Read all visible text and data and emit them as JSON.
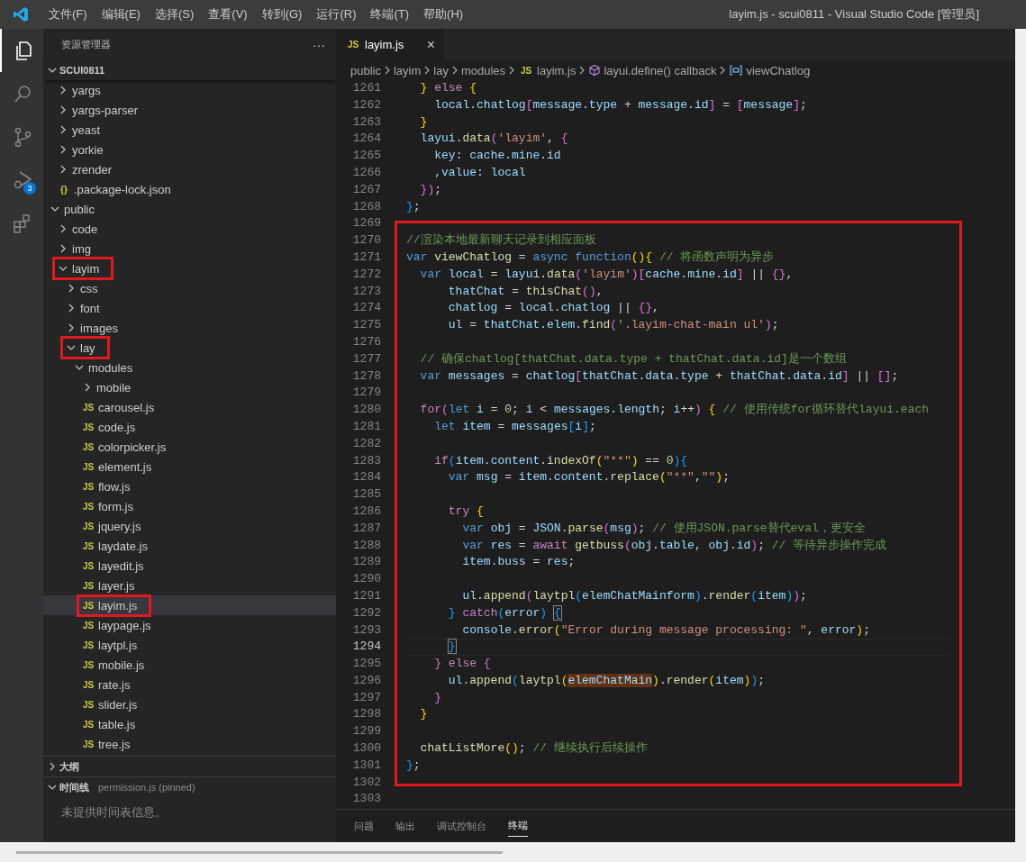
{
  "title_bar": {
    "menu": [
      "文件(F)",
      "编辑(E)",
      "选择(S)",
      "查看(V)",
      "转到(G)",
      "运行(R)",
      "终端(T)",
      "帮助(H)"
    ],
    "title": "layim.js - scui0811 - Visual Studio Code [管理员]"
  },
  "activity_bar": [
    {
      "kind": "files",
      "selected": true
    },
    {
      "kind": "search",
      "selected": false
    },
    {
      "kind": "source-control",
      "selected": false
    },
    {
      "kind": "debug",
      "selected": false,
      "badge": "3"
    },
    {
      "kind": "extensions",
      "selected": false
    }
  ],
  "sidebar": {
    "title": "资源管理器",
    "more": "···",
    "root": {
      "name": "SCUI0811",
      "expanded": true
    },
    "tree": [
      {
        "children": [
          {
            "name": "yargs",
            "kind": "folder",
            "expanded": false,
            "selected": false,
            "annotated": false
          },
          {
            "name": "yargs-parser",
            "kind": "folder",
            "expanded": false,
            "selected": false,
            "annotated": false
          },
          {
            "name": "yeast",
            "kind": "folder",
            "expanded": false,
            "selected": false,
            "annotated": false
          },
          {
            "name": "yorkie",
            "kind": "folder",
            "expanded": false,
            "selected": false,
            "annotated": false
          },
          {
            "name": "zrender",
            "kind": "folder",
            "expanded": false,
            "selected": false,
            "annotated": false
          },
          {
            "name": ".package-lock.json",
            "kind": "json",
            "icon_label": "{}",
            "selected": false,
            "annotated": false
          }
        ]
      },
      {
        "name": "public",
        "kind": "folder",
        "expanded": true,
        "selected": false,
        "annotated": false,
        "children": [
          {
            "name": "code",
            "kind": "folder",
            "expanded": false,
            "selected": false,
            "annotated": false
          },
          {
            "name": "img",
            "kind": "folder",
            "expanded": false,
            "selected": false,
            "annotated": false
          },
          {
            "name": "layim",
            "kind": "folder",
            "expanded": true,
            "selected": false,
            "annotated": true,
            "children": [
              {
                "name": "css",
                "kind": "folder",
                "expanded": false,
                "selected": false,
                "annotated": false
              },
              {
                "name": "font",
                "kind": "folder",
                "expanded": false,
                "selected": false,
                "annotated": false
              },
              {
                "name": "images",
                "kind": "folder",
                "expanded": false,
                "selected": false,
                "annotated": false
              },
              {
                "name": "lay",
                "kind": "folder",
                "expanded": true,
                "selected": false,
                "annotated": true,
                "children": [
                  {
                    "name": "modules",
                    "kind": "folder",
                    "expanded": true,
                    "selected": false,
                    "annotated": false,
                    "children": [
                      {
                        "name": "mobile",
                        "kind": "folder",
                        "expanded": false,
                        "selected": false,
                        "annotated": false
                      },
                      {
                        "name": "carousel.js",
                        "kind": "js",
                        "icon_label": "JS",
                        "selected": false,
                        "annotated": false
                      },
                      {
                        "name": "code.js",
                        "kind": "js",
                        "icon_label": "JS",
                        "selected": false,
                        "annotated": false
                      },
                      {
                        "name": "colorpicker.js",
                        "kind": "js",
                        "icon_label": "JS",
                        "selected": false,
                        "annotated": false
                      },
                      {
                        "name": "element.js",
                        "kind": "js",
                        "icon_label": "JS",
                        "selected": false,
                        "annotated": false
                      },
                      {
                        "name": "flow.js",
                        "kind": "js",
                        "icon_label": "JS",
                        "selected": false,
                        "annotated": false
                      },
                      {
                        "name": "form.js",
                        "kind": "js",
                        "icon_label": "JS",
                        "selected": false,
                        "annotated": false
                      },
                      {
                        "name": "jquery.js",
                        "kind": "js",
                        "icon_label": "JS",
                        "selected": false,
                        "annotated": false
                      },
                      {
                        "name": "laydate.js",
                        "kind": "js",
                        "icon_label": "JS",
                        "selected": false,
                        "annotated": false
                      },
                      {
                        "name": "layedit.js",
                        "kind": "js",
                        "icon_label": "JS",
                        "selected": false,
                        "annotated": false
                      },
                      {
                        "name": "layer.js",
                        "kind": "js",
                        "icon_label": "JS",
                        "selected": false,
                        "annotated": false
                      },
                      {
                        "name": "layim.js",
                        "kind": "js",
                        "icon_label": "JS",
                        "selected": true,
                        "annotated": true
                      },
                      {
                        "name": "laypage.js",
                        "kind": "js",
                        "icon_label": "JS",
                        "selected": false,
                        "annotated": false
                      },
                      {
                        "name": "laytpl.js",
                        "kind": "js",
                        "icon_label": "JS",
                        "selected": false,
                        "annotated": false
                      },
                      {
                        "name": "mobile.js",
                        "kind": "js",
                        "icon_label": "JS",
                        "selected": false,
                        "annotated": false
                      },
                      {
                        "name": "rate.js",
                        "kind": "js",
                        "icon_label": "JS",
                        "selected": false,
                        "annotated": false
                      },
                      {
                        "name": "slider.js",
                        "kind": "js",
                        "icon_label": "JS",
                        "selected": false,
                        "annotated": false
                      },
                      {
                        "name": "table.js",
                        "kind": "js",
                        "icon_label": "JS",
                        "selected": false,
                        "annotated": false
                      },
                      {
                        "name": "tree.js",
                        "kind": "js",
                        "icon_label": "JS",
                        "selected": false,
                        "annotated": false
                      }
                    ]
                  }
                ]
              }
            ]
          }
        ]
      }
    ],
    "sections": [
      {
        "title": "大纲",
        "expanded": false
      },
      {
        "title": "时间线",
        "expanded": true,
        "detail": "permission.js (pinned)",
        "message": "未提供时间表信息。"
      }
    ]
  },
  "editor": {
    "tabs": [
      {
        "label": "layim.js",
        "icon_label": "JS",
        "selected": true,
        "close": "×"
      }
    ],
    "breadcrumbs": [
      {
        "text": "public",
        "kind": "folder"
      },
      {
        "text": "layim",
        "kind": "folder"
      },
      {
        "text": "lay",
        "kind": "folder"
      },
      {
        "text": "modules",
        "kind": "folder"
      },
      {
        "text": "layim.js",
        "kind": "js",
        "icon_label": "JS"
      },
      {
        "text": "layui.define() callback",
        "kind": "method"
      },
      {
        "text": "viewChatlog",
        "kind": "variable"
      }
    ],
    "blocks": [
      {
        "kind": "plain",
        "lines": [
          {
            "n": "1261",
            "current": false,
            "tokens": [
              {
                "text": "  } ",
                "kind": "b1"
              },
              {
                "text": "else ",
                "kind": "ctl"
              },
              {
                "text": "{",
                "kind": "b1"
              }
            ]
          },
          {
            "n": "1262",
            "current": false,
            "tokens": [
              {
                "text": "    local.chatlog",
                "kind": "var"
              },
              {
                "text": "[",
                "kind": "b2"
              },
              {
                "text": "message.type",
                "kind": "var"
              },
              {
                "text": " + ",
                "kind": "p"
              },
              {
                "text": "message.id",
                "kind": "var"
              },
              {
                "text": "]",
                "kind": "b2"
              },
              {
                "text": " = ",
                "kind": "p"
              },
              {
                "text": "[",
                "kind": "b2"
              },
              {
                "text": "message",
                "kind": "var"
              },
              {
                "text": "]",
                "kind": "b2"
              },
              {
                "text": ";",
                "kind": "p"
              }
            ]
          },
          {
            "n": "1263",
            "current": false,
            "tokens": [
              {
                "text": "  }",
                "kind": "b1"
              }
            ]
          },
          {
            "n": "1264",
            "current": false,
            "tokens": [
              {
                "text": "  layui",
                "kind": "var"
              },
              {
                "text": ".",
                "kind": "p"
              },
              {
                "text": "data",
                "kind": "fn"
              },
              {
                "text": "(",
                "kind": "b2"
              },
              {
                "text": "'layim'",
                "kind": "str"
              },
              {
                "text": ", ",
                "kind": "p"
              },
              {
                "text": "{",
                "kind": "b2"
              }
            ]
          },
          {
            "n": "1265",
            "current": false,
            "tokens": [
              {
                "text": "    key",
                "kind": "var"
              },
              {
                "text": ": ",
                "kind": "p"
              },
              {
                "text": "cache.mine.id",
                "kind": "var"
              }
            ]
          },
          {
            "n": "1266",
            "current": false,
            "tokens": [
              {
                "text": "    ,value",
                "kind": "var"
              },
              {
                "text": ": ",
                "kind": "p"
              },
              {
                "text": "local",
                "kind": "var"
              }
            ]
          },
          {
            "n": "1267",
            "current": false,
            "tokens": [
              {
                "text": "  }",
                "kind": "b2"
              },
              {
                "text": ")",
                "kind": "b2"
              },
              {
                "text": ";",
                "kind": "p"
              }
            ]
          },
          {
            "n": "1268",
            "current": false,
            "tokens": [
              {
                "text": "}",
                "kind": "b3"
              },
              {
                "text": ";",
                "kind": "p"
              }
            ]
          },
          {
            "n": "1269",
            "current": false
          }
        ]
      },
      {
        "kind": "annotated",
        "lines": [
          {
            "n": "1270",
            "current": false,
            "tokens": [
              {
                "text": "//渲染本地最新聊天记录到相应面板",
                "kind": "cmt"
              }
            ]
          },
          {
            "n": "1271",
            "current": false,
            "tokens": [
              {
                "text": "var ",
                "kind": "kw"
              },
              {
                "text": "viewChatlog",
                "kind": "fn"
              },
              {
                "text": " = ",
                "kind": "p"
              },
              {
                "text": "async function",
                "kind": "kw"
              },
              {
                "text": "(){",
                "kind": "b1"
              },
              {
                "text": " // 将函数声明为异步",
                "kind": "cmt"
              }
            ]
          },
          {
            "n": "1272",
            "current": false,
            "tokens": [
              {
                "text": "  var ",
                "kind": "kw"
              },
              {
                "text": "local",
                "kind": "var"
              },
              {
                "text": " = ",
                "kind": "p"
              },
              {
                "text": "layui",
                "kind": "var"
              },
              {
                "text": ".",
                "kind": "p"
              },
              {
                "text": "data",
                "kind": "fn"
              },
              {
                "text": "(",
                "kind": "b2"
              },
              {
                "text": "'layim'",
                "kind": "str"
              },
              {
                "text": ")[",
                "kind": "b2"
              },
              {
                "text": "cache.mine.id",
                "kind": "var"
              },
              {
                "text": "]",
                "kind": "b2"
              },
              {
                "text": " || ",
                "kind": "p"
              },
              {
                "text": "{}",
                "kind": "b2"
              },
              {
                "text": ",",
                "kind": "p"
              }
            ]
          },
          {
            "n": "1273",
            "current": false,
            "tokens": [
              {
                "text": "      thatChat",
                "kind": "var"
              },
              {
                "text": " = ",
                "kind": "p"
              },
              {
                "text": "thisChat",
                "kind": "fn"
              },
              {
                "text": "()",
                "kind": "b2"
              },
              {
                "text": ",",
                "kind": "p"
              }
            ]
          },
          {
            "n": "1274",
            "current": false,
            "tokens": [
              {
                "text": "      chatlog",
                "kind": "var"
              },
              {
                "text": " = ",
                "kind": "p"
              },
              {
                "text": "local.chatlog",
                "kind": "var"
              },
              {
                "text": " || ",
                "kind": "p"
              },
              {
                "text": "{}",
                "kind": "b2"
              },
              {
                "text": ",",
                "kind": "p"
              }
            ]
          },
          {
            "n": "1275",
            "current": false,
            "tokens": [
              {
                "text": "      ul",
                "kind": "var"
              },
              {
                "text": " = ",
                "kind": "p"
              },
              {
                "text": "thatChat.elem.",
                "kind": "var"
              },
              {
                "text": "find",
                "kind": "fn"
              },
              {
                "text": "(",
                "kind": "b2"
              },
              {
                "text": "'.layim-chat-main ul'",
                "kind": "str"
              },
              {
                "text": ")",
                "kind": "b2"
              },
              {
                "text": ";",
                "kind": "p"
              }
            ]
          },
          {
            "n": "1276",
            "current": false
          },
          {
            "n": "1277",
            "current": false,
            "tokens": [
              {
                "text": "  // 确保chatlog[thatChat.data.type + thatChat.data.id]是一个数组",
                "kind": "cmt"
              }
            ]
          },
          {
            "n": "1278",
            "current": false,
            "tokens": [
              {
                "text": "  var ",
                "kind": "kw"
              },
              {
                "text": "messages",
                "kind": "var"
              },
              {
                "text": " = ",
                "kind": "p"
              },
              {
                "text": "chatlog",
                "kind": "var"
              },
              {
                "text": "[",
                "kind": "b2"
              },
              {
                "text": "thatChat.data.type",
                "kind": "var"
              },
              {
                "text": " + ",
                "kind": "p"
              },
              {
                "text": "thatChat.data.id",
                "kind": "var"
              },
              {
                "text": "]",
                "kind": "b2"
              },
              {
                "text": " || ",
                "kind": "p"
              },
              {
                "text": "[]",
                "kind": "b2"
              },
              {
                "text": ";",
                "kind": "p"
              }
            ]
          },
          {
            "n": "1279",
            "current": false
          },
          {
            "n": "1280",
            "current": false,
            "tokens": [
              {
                "text": "  for",
                "kind": "ctl"
              },
              {
                "text": "(",
                "kind": "b2"
              },
              {
                "text": "let ",
                "kind": "kw"
              },
              {
                "text": "i",
                "kind": "var"
              },
              {
                "text": " = ",
                "kind": "p"
              },
              {
                "text": "0",
                "kind": "num"
              },
              {
                "text": "; ",
                "kind": "p"
              },
              {
                "text": "i",
                "kind": "var"
              },
              {
                "text": " < ",
                "kind": "p"
              },
              {
                "text": "messages.length",
                "kind": "var"
              },
              {
                "text": "; ",
                "kind": "p"
              },
              {
                "text": "i",
                "kind": "var"
              },
              {
                "text": "++",
                "kind": "p"
              },
              {
                "text": ") ",
                "kind": "b2"
              },
              {
                "text": "{",
                "kind": "b1"
              },
              {
                "text": " // 使用传统for循环替代layui.each",
                "kind": "cmt"
              }
            ]
          },
          {
            "n": "1281",
            "current": false,
            "tokens": [
              {
                "text": "    let ",
                "kind": "kw"
              },
              {
                "text": "item",
                "kind": "var"
              },
              {
                "text": " = ",
                "kind": "p"
              },
              {
                "text": "messages",
                "kind": "var"
              },
              {
                "text": "[",
                "kind": "b3"
              },
              {
                "text": "i",
                "kind": "var"
              },
              {
                "text": "]",
                "kind": "b3"
              },
              {
                "text": ";",
                "kind": "p"
              }
            ]
          },
          {
            "n": "1282",
            "current": false
          },
          {
            "n": "1283",
            "current": false,
            "tokens": [
              {
                "text": "    if",
                "kind": "ctl"
              },
              {
                "text": "(",
                "kind": "b3"
              },
              {
                "text": "item.content.",
                "kind": "var"
              },
              {
                "text": "indexOf",
                "kind": "fn"
              },
              {
                "text": "(",
                "kind": "b1"
              },
              {
                "text": "\"**\"",
                "kind": "str"
              },
              {
                "text": ")",
                "kind": "b1"
              },
              {
                "text": " == ",
                "kind": "p"
              },
              {
                "text": "0",
                "kind": "num"
              },
              {
                "text": "){",
                "kind": "b3"
              }
            ]
          },
          {
            "n": "1284",
            "current": false,
            "tokens": [
              {
                "text": "      var ",
                "kind": "kw"
              },
              {
                "text": "msg",
                "kind": "var"
              },
              {
                "text": " = ",
                "kind": "p"
              },
              {
                "text": "item.content.",
                "kind": "var"
              },
              {
                "text": "replace",
                "kind": "fn"
              },
              {
                "text": "(",
                "kind": "b1"
              },
              {
                "text": "\"**\"",
                "kind": "str"
              },
              {
                "text": ",",
                "kind": "p"
              },
              {
                "text": "\"\"",
                "kind": "str"
              },
              {
                "text": ")",
                "kind": "b1"
              },
              {
                "text": ";",
                "kind": "p"
              }
            ]
          },
          {
            "n": "1285",
            "current": false
          },
          {
            "n": "1286",
            "current": false,
            "tokens": [
              {
                "text": "      try ",
                "kind": "ctl"
              },
              {
                "text": "{",
                "kind": "b1"
              }
            ]
          },
          {
            "n": "1287",
            "current": false,
            "tokens": [
              {
                "text": "        var ",
                "kind": "kw"
              },
              {
                "text": "obj",
                "kind": "var"
              },
              {
                "text": " = ",
                "kind": "p"
              },
              {
                "text": "JSON",
                "kind": "var"
              },
              {
                "text": ".",
                "kind": "p"
              },
              {
                "text": "parse",
                "kind": "fn"
              },
              {
                "text": "(",
                "kind": "b2"
              },
              {
                "text": "msg",
                "kind": "var"
              },
              {
                "text": ")",
                "kind": "b2"
              },
              {
                "text": "; ",
                "kind": "p"
              },
              {
                "text": "// 使用JSON.parse替代eval，更安全",
                "kind": "cmt"
              }
            ]
          },
          {
            "n": "1288",
            "current": false,
            "tokens": [
              {
                "text": "        var ",
                "kind": "kw"
              },
              {
                "text": "res",
                "kind": "var"
              },
              {
                "text": " = ",
                "kind": "p"
              },
              {
                "text": "await ",
                "kind": "ctl"
              },
              {
                "text": "getbuss",
                "kind": "fn"
              },
              {
                "text": "(",
                "kind": "b2"
              },
              {
                "text": "obj.table",
                "kind": "var"
              },
              {
                "text": ", ",
                "kind": "p"
              },
              {
                "text": "obj.id",
                "kind": "var"
              },
              {
                "text": ")",
                "kind": "b2"
              },
              {
                "text": "; ",
                "kind": "p"
              },
              {
                "text": "// 等待异步操作完成",
                "kind": "cmt"
              }
            ]
          },
          {
            "n": "1289",
            "current": false,
            "tokens": [
              {
                "text": "        item.buss",
                "kind": "var"
              },
              {
                "text": " = ",
                "kind": "p"
              },
              {
                "text": "res",
                "kind": "var"
              },
              {
                "text": ";",
                "kind": "p"
              }
            ]
          },
          {
            "n": "1290",
            "current": false
          },
          {
            "n": "1291",
            "current": false,
            "tokens": [
              {
                "text": "        ul.",
                "kind": "var"
              },
              {
                "text": "append",
                "kind": "fn"
              },
              {
                "text": "(",
                "kind": "b2"
              },
              {
                "text": "laytpl",
                "kind": "fn"
              },
              {
                "text": "(",
                "kind": "b3"
              },
              {
                "text": "elemChatMainform",
                "kind": "var"
              },
              {
                "text": ")",
                "kind": "b3"
              },
              {
                "text": ".",
                "kind": "p"
              },
              {
                "text": "render",
                "kind": "fn"
              },
              {
                "text": "(",
                "kind": "b3"
              },
              {
                "text": "item",
                "kind": "var"
              },
              {
                "text": ")",
                "kind": "b3"
              },
              {
                "text": ")",
                "kind": "b2"
              },
              {
                "text": ";",
                "kind": "p"
              }
            ]
          },
          {
            "n": "1292",
            "current": false,
            "tokens": [
              {
                "text": "      } ",
                "kind": "b3"
              },
              {
                "text": "catch",
                "kind": "ctl"
              },
              {
                "text": "(",
                "kind": "b3"
              },
              {
                "text": "error",
                "kind": "var"
              },
              {
                "text": ") ",
                "kind": "b3"
              },
              {
                "text": "{",
                "kind": "bracket-match"
              }
            ]
          },
          {
            "n": "1293",
            "current": false,
            "tokens": [
              {
                "text": "        console.",
                "kind": "var"
              },
              {
                "text": "error",
                "kind": "fn"
              },
              {
                "text": "(",
                "kind": "b1"
              },
              {
                "text": "\"Error during message processing: \"",
                "kind": "str"
              },
              {
                "text": ", ",
                "kind": "p"
              },
              {
                "text": "error",
                "kind": "var"
              },
              {
                "text": ")",
                "kind": "b1"
              },
              {
                "text": ";",
                "kind": "p"
              }
            ]
          },
          {
            "n": "1294",
            "current": true,
            "tokens": [
              {
                "text": "      }",
                "kind": "bracket-match"
              }
            ]
          },
          {
            "n": "1295",
            "current": false,
            "tokens": [
              {
                "text": "    } ",
                "kind": "b2"
              },
              {
                "text": "else ",
                "kind": "ctl"
              },
              {
                "text": "{",
                "kind": "b2"
              }
            ]
          },
          {
            "n": "1296",
            "current": false,
            "tokens": [
              {
                "text": "      ul.",
                "kind": "var"
              },
              {
                "text": "append",
                "kind": "fn"
              },
              {
                "text": "(",
                "kind": "b3"
              },
              {
                "text": "laytpl",
                "kind": "fn"
              },
              {
                "text": "(",
                "kind": "b1"
              },
              {
                "text": "elemChatMain",
                "kind": "match"
              },
              {
                "text": ")",
                "kind": "b1"
              },
              {
                "text": ".",
                "kind": "p"
              },
              {
                "text": "render",
                "kind": "fn"
              },
              {
                "text": "(",
                "kind": "b1"
              },
              {
                "text": "item",
                "kind": "var"
              },
              {
                "text": ")",
                "kind": "b1"
              },
              {
                "text": ")",
                "kind": "b3"
              },
              {
                "text": ";",
                "kind": "p"
              }
            ]
          },
          {
            "n": "1297",
            "current": false,
            "tokens": [
              {
                "text": "    }",
                "kind": "b2"
              }
            ]
          },
          {
            "n": "1298",
            "current": false,
            "tokens": [
              {
                "text": "  }",
                "kind": "b1"
              }
            ]
          },
          {
            "n": "1299",
            "current": false
          },
          {
            "n": "1300",
            "current": false,
            "tokens": [
              {
                "text": "  chatListMore",
                "kind": "fn"
              },
              {
                "text": "()",
                "kind": "b1"
              },
              {
                "text": "; ",
                "kind": "p"
              },
              {
                "text": "// 继续执行后续操作",
                "kind": "cmt"
              }
            ]
          },
          {
            "n": "1301",
            "current": false,
            "tokens": [
              {
                "text": "}",
                "kind": "b3"
              },
              {
                "text": ";",
                "kind": "p"
              }
            ]
          }
        ]
      },
      {
        "kind": "plain",
        "lines": [
          {
            "n": "1302",
            "current": false
          },
          {
            "n": "1303",
            "current": false
          }
        ]
      }
    ]
  },
  "panel": {
    "tabs": [
      {
        "label": "问题",
        "selected": false
      },
      {
        "label": "输出",
        "selected": false
      },
      {
        "label": "调试控制台",
        "selected": false
      },
      {
        "label": "终端",
        "selected": true
      }
    ]
  }
}
